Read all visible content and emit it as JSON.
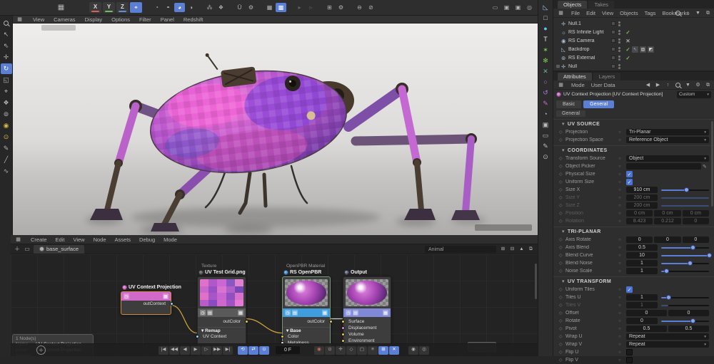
{
  "colors": {
    "accent_blue": "#5b7fd4",
    "check_green": "#7dc24a",
    "wire_yellow": "#c9a23a",
    "node_pink": "#d069c8",
    "openpbr_bar": "#3f9ddd",
    "output_bar": "#8089d8",
    "selection_orange": "#cf8a3a"
  },
  "top_toolbar": {
    "axis_buttons": [
      {
        "label": "X",
        "color": "#d95f5f"
      },
      {
        "label": "Y",
        "color": "#6fbf5f"
      },
      {
        "label": "Z",
        "color": "#5f8fd9"
      }
    ],
    "coord_toggle": {
      "glyph": "⌖",
      "active": true
    },
    "layout_icon": "▦",
    "icon_groups": [
      {
        "icons": [
          {
            "name": "render-view-icon",
            "g": "◔"
          },
          {
            "name": "render-region-icon",
            "g": "◓"
          },
          {
            "name": "render-active-icon",
            "g": "◕",
            "active": true
          },
          {
            "name": "render-settings-icon",
            "g": "◑"
          }
        ]
      },
      {
        "icons": [
          {
            "name": "team-render-icon",
            "g": "⁂"
          },
          {
            "name": "render-queue-icon",
            "g": "❖"
          }
        ]
      },
      {
        "icons": [
          {
            "name": "magic-solo-icon",
            "g": "Ū"
          },
          {
            "name": "solo-settings-icon",
            "g": "⚙"
          }
        ]
      },
      {
        "icons": [
          {
            "name": "grid-snap-icon",
            "g": "▦"
          },
          {
            "name": "quantize-icon",
            "g": "▩",
            "active": true
          }
        ]
      },
      {
        "dim": true,
        "icons": [
          {
            "name": "history-back-icon",
            "g": "▸"
          },
          {
            "name": "history-fwd-icon",
            "g": "▹"
          }
        ]
      },
      {
        "icons": [
          {
            "name": "workplane-icon",
            "g": "⊞"
          },
          {
            "name": "workplane-settings-icon",
            "g": "⚙"
          }
        ]
      },
      {
        "icons": [
          {
            "name": "lock-axis-icon",
            "g": "⊖"
          },
          {
            "name": "disable-icon",
            "g": "⊘"
          }
        ]
      }
    ],
    "right_icons": [
      {
        "name": "window-layout-icon",
        "g": "▭"
      },
      {
        "name": "panel-a-icon",
        "g": "▣"
      },
      {
        "name": "panel-b-icon",
        "g": "▣"
      },
      {
        "name": "user-icon",
        "g": "◎"
      }
    ]
  },
  "left_toolbar": {
    "tools": [
      {
        "name": "search-tool",
        "g": "mag"
      },
      {
        "name": "live-selection-tool",
        "g": "↖"
      },
      {
        "name": "selection-filter-tool",
        "g": "⇖"
      },
      {
        "name": "move-tool",
        "g": "✛"
      },
      {
        "name": "rotate-tool",
        "g": "↻",
        "active": true
      },
      {
        "name": "scale-tool",
        "g": "◱"
      },
      {
        "name": "axis-tool",
        "g": "⌖"
      },
      {
        "name": "model-mode-tool",
        "g": "❖"
      },
      {
        "name": "points-mode-tool",
        "g": "⊚"
      },
      {
        "name": "brush-tool",
        "g": "◉",
        "c": "#d8b84a"
      },
      {
        "name": "paint-tool",
        "g": "⊙",
        "c": "#d8b84a"
      },
      {
        "name": "pen-tool",
        "g": "✎"
      },
      {
        "name": "knife-tool",
        "g": "╱"
      },
      {
        "name": "spline-smooth-tool",
        "g": "∿"
      }
    ]
  },
  "viewport": {
    "menu": [
      "View",
      "Cameras",
      "Display",
      "Options",
      "Filter",
      "Panel",
      "Redshift"
    ]
  },
  "palette": {
    "icons": [
      {
        "name": "asset-corner-icon",
        "g": "◺",
        "c": "#9ac4f8"
      },
      {
        "name": "cube-primitive-icon",
        "g": "□",
        "c": "#c8c8c8"
      },
      {
        "name": "volume-icon",
        "g": "●",
        "c": "#5bc8f0"
      },
      {
        "name": "motext-icon",
        "g": "T",
        "c": "#e8e8e8"
      },
      {
        "name": "generator-icon",
        "g": "✶",
        "c": "#7ec855"
      },
      {
        "name": "cloner-icon",
        "g": "✻",
        "c": "#7ec855"
      },
      {
        "name": "effector-icon",
        "g": "✕",
        "c": "#6ab0a0"
      },
      {
        "name": "spline-circle-icon",
        "g": "○",
        "c": "#b07ae0"
      },
      {
        "name": "spline-arc-icon",
        "g": "↺",
        "c": "#b07ae0"
      },
      {
        "name": "spline-pen-icon",
        "g": "✎",
        "c": "#d069c8"
      },
      {
        "name": "clock-icon",
        "g": "◔",
        "c": "#bdbdbd"
      },
      {
        "name": "camera-icon",
        "g": "▣",
        "c": "#bdbdbd"
      },
      {
        "name": "display-icon",
        "g": "▭",
        "c": "#bdbdbd"
      },
      {
        "name": "annotate-icon",
        "g": "✎",
        "c": "#bdbdbd"
      },
      {
        "name": "target-icon",
        "g": "⊙",
        "c": "#bdbdbd"
      }
    ]
  },
  "objects_panel": {
    "tabs": [
      "Objects",
      "Takes"
    ],
    "active_tab": "Objects",
    "menu": [
      "File",
      "Edit",
      "View",
      "Objects",
      "Tags",
      "Bookmarks"
    ],
    "header_icons": [
      {
        "name": "search-icon",
        "g": "mag"
      },
      {
        "name": "home-icon",
        "g": "⌂"
      },
      {
        "name": "filter-icon",
        "g": "▼"
      },
      {
        "name": "expand-icon",
        "g": "⧉"
      }
    ],
    "items": [
      {
        "name": "Null.1",
        "icon": "null",
        "glyph": "✛",
        "state": "",
        "tags": []
      },
      {
        "name": "RS Infinite Light",
        "icon": "light",
        "glyph": "☼",
        "state": "check",
        "tags": []
      },
      {
        "name": "RS Camera",
        "icon": "camera",
        "glyph": "◉",
        "state": "cross",
        "tags": []
      },
      {
        "name": "Backdrop",
        "icon": "backdrop",
        "glyph": "◺",
        "state": "check",
        "tags": [
          {
            "name": "pointer-tag",
            "g": "↖",
            "c": "#7ab0f0"
          },
          {
            "name": "uv-tag",
            "g": "▨",
            "c": "#ddd"
          },
          {
            "name": "texture-tag",
            "g": "◩",
            "c": "#ddd"
          }
        ]
      },
      {
        "name": "RS External",
        "icon": "external",
        "glyph": "⊛",
        "state": "check",
        "tags": []
      },
      {
        "name": "Null",
        "icon": "null",
        "glyph": "✛",
        "state": "",
        "expander": true,
        "tags": []
      }
    ]
  },
  "attributes_panel": {
    "tabs": [
      "Attributes",
      "Layers"
    ],
    "active_tab": "Attributes",
    "menu": [
      "Mode",
      "User Data"
    ],
    "header_icons": [
      {
        "name": "back-icon",
        "g": "◀"
      },
      {
        "name": "forward-icon",
        "g": "▶"
      },
      {
        "name": "up-icon",
        "g": "↑"
      },
      {
        "name": "search-icon",
        "g": "mag"
      },
      {
        "name": "filter-icon",
        "g": "▼"
      },
      {
        "name": "gear-icon",
        "g": "⚙"
      },
      {
        "name": "new-panel-icon",
        "g": "⧉"
      }
    ],
    "title": "UV Context Projection [UV Context Projection]",
    "preset_dropdown": "Custom",
    "section_buttons": [
      "Basic",
      "General"
    ],
    "active_section_button": "General",
    "group_label": "General",
    "sections": [
      {
        "title": "UV SOURCE",
        "rows": [
          {
            "label": "Projection",
            "type": "dropdown",
            "value": "Tri-Planar"
          },
          {
            "label": "Projection Space",
            "type": "dropdown",
            "value": "Reference Object"
          }
        ]
      },
      {
        "title": "COORDINATES",
        "rows": [
          {
            "label": "Transform Source",
            "type": "dropdown",
            "value": "Object"
          },
          {
            "label": "Object Picker",
            "type": "picker",
            "value": ""
          },
          {
            "label": "Physical Size",
            "type": "checkbox",
            "checked": true
          },
          {
            "label": "Uniform Size",
            "type": "checkbox",
            "checked": true
          },
          {
            "label": "Size X",
            "type": "slider",
            "value": "910 cm",
            "pct": 52
          },
          {
            "label": "Size Y",
            "type": "slider",
            "value": "200 cm",
            "pct": 100,
            "disabled": true
          },
          {
            "label": "Size Z",
            "type": "slider",
            "value": "200 cm",
            "pct": 100,
            "disabled": true
          },
          {
            "label": "Position",
            "type": "fields",
            "values": [
              "0 cm",
              "0 cm",
              "0 cm"
            ],
            "disabled": true
          },
          {
            "label": "Rotation",
            "type": "fields",
            "values": [
              "8.423",
              "0.212",
              "0"
            ],
            "disabled": true
          }
        ]
      },
      {
        "title": "TRI-PLANAR",
        "rows": [
          {
            "label": "Axis Rotate",
            "type": "fields",
            "values": [
              "0",
              "0",
              "0"
            ]
          },
          {
            "label": "Axis Blend",
            "type": "slider",
            "value": "0.5",
            "pct": 65
          },
          {
            "label": "Blend Curve",
            "type": "slider",
            "value": "10",
            "pct": 100
          },
          {
            "label": "Blend Noise",
            "type": "slider",
            "value": "1",
            "pct": 60
          },
          {
            "label": "Noise Scale",
            "type": "slider",
            "value": "1",
            "pct": 10
          }
        ]
      },
      {
        "title": "UV TRANSFORM",
        "rows": [
          {
            "label": "Uniform Tiles",
            "type": "checkbox",
            "checked": true
          },
          {
            "label": "Tiles U",
            "type": "slider",
            "value": "1",
            "pct": 15
          },
          {
            "label": "Tiles V",
            "type": "slider",
            "value": "1",
            "pct": 15,
            "disabled": true
          },
          {
            "label": "Offset",
            "type": "fields",
            "values": [
              "0",
              "0"
            ]
          },
          {
            "label": "Rotate",
            "type": "slider",
            "value": "0",
            "pct": 65
          },
          {
            "label": "Pivot",
            "type": "fields",
            "values": [
              "0.5",
              "0.5"
            ]
          },
          {
            "label": "Wrap U",
            "type": "dropdown",
            "value": "Repeat"
          },
          {
            "label": "Wrap V",
            "type": "dropdown",
            "value": "Repeat"
          },
          {
            "label": "Flip U",
            "type": "checkbox",
            "checked": false
          },
          {
            "label": "Flip V",
            "type": "checkbox",
            "checked": false
          }
        ]
      }
    ]
  },
  "node_editor": {
    "menu": [
      "Create",
      "Edit",
      "View",
      "Node",
      "Assets",
      "Debug",
      "Mode"
    ],
    "right_icons": [
      {
        "name": "dock-icon",
        "g": "⊞"
      },
      {
        "name": "undock-icon",
        "g": "⊟"
      },
      {
        "name": "pin-icon",
        "g": "▲"
      },
      {
        "name": "new-window-icon",
        "g": "⧉"
      }
    ],
    "tab": "base_surface",
    "search_value": "Animal",
    "info_box": {
      "count": "1 Node(s)",
      "rows": [
        {
          "k": "Name",
          "v": "UV Context Projection"
        },
        {
          "k": "Asset",
          "v": "UV Context Projection"
        },
        {
          "k": "Version",
          "v": ""
        }
      ]
    },
    "nodes": [
      {
        "id": "uvproj",
        "category": "",
        "title": "UV Context Projection",
        "selected": true,
        "outputs": [
          {
            "name": "outContext",
            "color": "#8fd6f0"
          }
        ]
      },
      {
        "id": "texture",
        "category": "Texture",
        "title": "UV Test Grid.png",
        "outputs": [
          {
            "name": "outColor",
            "color": "#e3c94e"
          }
        ],
        "groups": [
          {
            "name": "Remap",
            "inputs": [
              {
                "name": "UV Context",
                "color": "#8fd6f0"
              }
            ]
          }
        ]
      },
      {
        "id": "openpbr",
        "category": "OpenPBR Material",
        "title": "RS OpenPBR",
        "outputs": [
          {
            "name": "outColor",
            "color": "#e3c94e"
          }
        ],
        "groups": [
          {
            "name": "Base",
            "inputs": [
              {
                "name": "Color",
                "color": "#e3c94e"
              },
              {
                "name": "Metalness",
                "color": "#e8e8e8"
              }
            ]
          }
        ]
      },
      {
        "id": "output",
        "category": "",
        "title": "Output",
        "inputs": [
          {
            "name": "Surface",
            "color": "#e3c94e"
          },
          {
            "name": "Displacement",
            "color": "#e08ad8"
          },
          {
            "name": "Volume",
            "color": "#e3c94e"
          },
          {
            "name": "Environment",
            "color": "#e3c94e"
          }
        ]
      }
    ],
    "texture_palette": [
      "#e070c8",
      "#b058c8",
      "#cc66d4",
      "#8858c0",
      "#e080d0",
      "#c868cc",
      "#9a50c4",
      "#d873d0",
      "#b05ec8",
      "#7848b8",
      "#e070c8",
      "#a855c8",
      "#c865d0",
      "#9050c0",
      "#d870cc",
      "#b85cc8",
      "#8a4cc0",
      "#d068cc",
      "#a054c4",
      "#e47ad4"
    ]
  },
  "transport": {
    "playback": [
      {
        "name": "goto-start-button",
        "g": "|◀"
      },
      {
        "name": "prev-key-button",
        "g": "◀◀"
      },
      {
        "name": "prev-frame-button",
        "g": "◀"
      },
      {
        "name": "play-backward-button",
        "g": "▶"
      },
      {
        "name": "play-button",
        "g": "▷"
      },
      {
        "name": "next-key-button",
        "g": "▶▶"
      },
      {
        "name": "goto-end-button",
        "g": "▶|"
      }
    ],
    "toggles": [
      {
        "name": "loop-toggle",
        "g": "⟲"
      },
      {
        "name": "pingpong-toggle",
        "g": "⇄"
      },
      {
        "name": "sound-toggle",
        "g": "⊙"
      }
    ],
    "frame_field": "0 F",
    "keys": [
      {
        "name": "record-button",
        "g": "◉",
        "c": "#c96a5a"
      },
      {
        "name": "autokey-button",
        "g": "⊙"
      },
      {
        "name": "key-position-button",
        "g": "✛"
      },
      {
        "name": "key-scale-button",
        "g": "◇"
      },
      {
        "name": "key-rotation-button",
        "g": "▢"
      },
      {
        "name": "key-parameter-button",
        "g": "≡"
      },
      {
        "name": "key-pla-button",
        "g": "⊞",
        "active": true
      },
      {
        "name": "keyframe-selection-button",
        "g": "✕",
        "active": true
      }
    ],
    "extra": [
      {
        "name": "solo-button",
        "g": "◉"
      },
      {
        "name": "solo-mode-button",
        "g": "◎"
      }
    ]
  }
}
